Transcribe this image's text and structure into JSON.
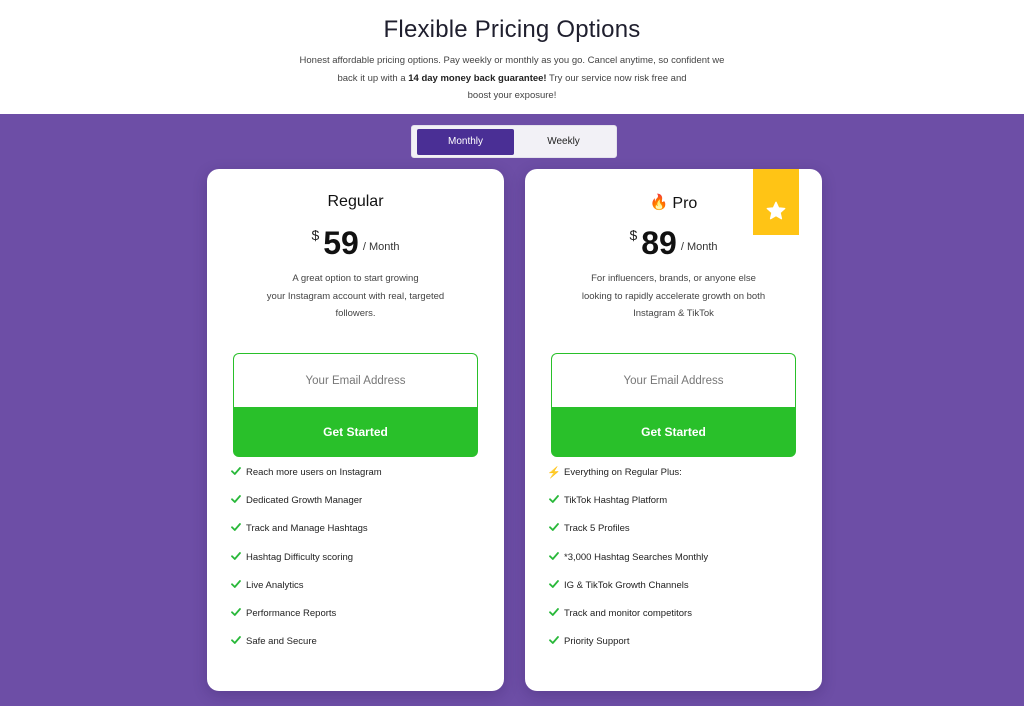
{
  "header": {
    "title": "Flexible Pricing Options",
    "subtitle_line1": "Honest affordable pricing options. Pay weekly or monthly as you go. Cancel anytime, so confident we",
    "subtitle_pre": "back it up with a ",
    "subtitle_bold": "14 day money back guarantee!",
    "subtitle_post": " Try our service now risk free and",
    "subtitle_line3": "boost your exposure!"
  },
  "toggle": {
    "monthly": "Monthly",
    "weekly": "Weekly",
    "selected": "Monthly"
  },
  "plans": [
    {
      "name": "Regular",
      "currency": "$",
      "price": "59",
      "period": "/ Month",
      "description": [
        "A great option to start growing",
        "your Instagram account with real, targeted",
        "followers."
      ],
      "email_placeholder": "Your Email Address",
      "cta": "Get Started",
      "features": [
        "Reach more users on Instagram",
        "Dedicated Growth Manager",
        "Track and Manage Hashtags",
        "Hashtag Difficulty scoring",
        "Live Analytics",
        "Performance Reports",
        "Safe and Secure"
      ]
    },
    {
      "name": "Pro",
      "icon": "fire-icon",
      "badge_icon": "star-icon",
      "currency": "$",
      "price": "89",
      "period": "/ Month",
      "description": [
        "For influencers, brands, or anyone else",
        "looking to rapidly accelerate growth on both",
        "Instagram & TikTok"
      ],
      "email_placeholder": "Your Email Address",
      "cta": "Get Started",
      "features_header": "Everything on Regular Plus:",
      "features": [
        "TikTok Hashtag Platform",
        "Track 5 Profiles",
        "*3,000 Hashtag Searches Monthly",
        "IG & TikTok Growth Channels",
        "Track and monitor competitors",
        "Priority Support"
      ]
    }
  ],
  "colors": {
    "purple": "#6d4ea6",
    "toggle_active": "#4a2f95",
    "cta_green": "#29c02a",
    "check_green": "#29b83a",
    "ribbon": "#ffc415"
  }
}
